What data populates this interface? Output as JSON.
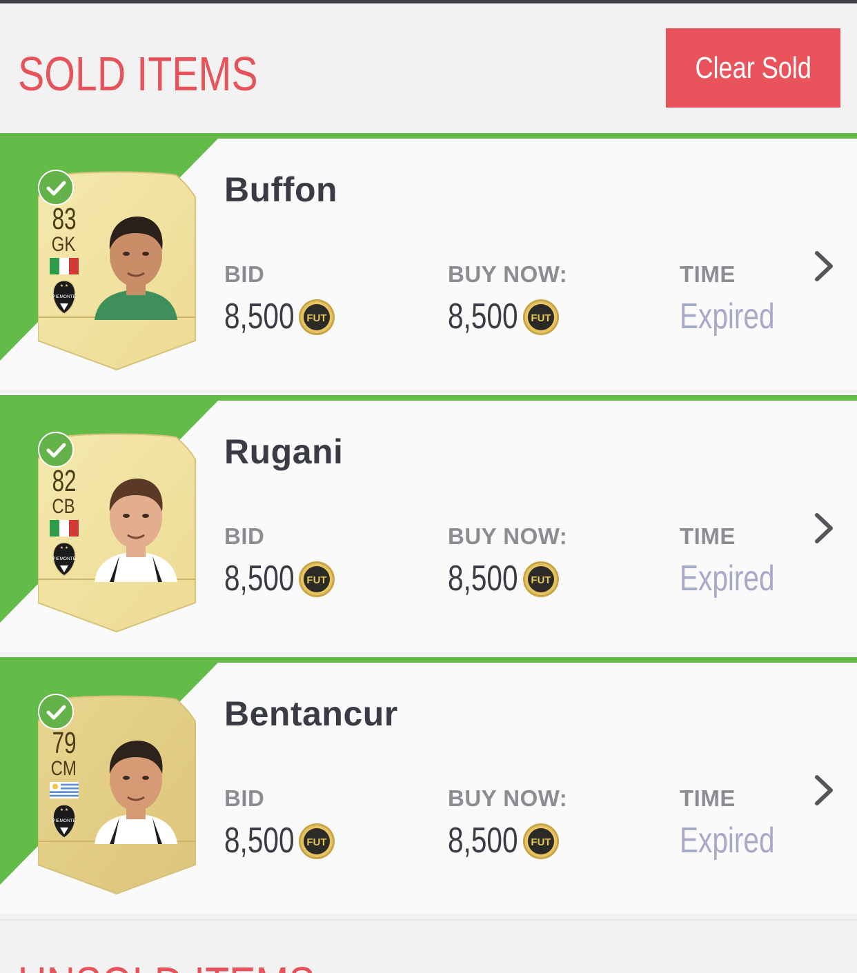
{
  "header": {
    "title": "SOLD ITEMS",
    "clear_button": "Clear Sold"
  },
  "labels": {
    "bid": "BID",
    "buy_now": "BUY NOW:",
    "time": "TIME"
  },
  "items": [
    {
      "name": "Buffon",
      "rating": "83",
      "position": "GK",
      "nation": "italy-flag",
      "club": "PIEMONTE",
      "bid": "8,500",
      "buy_now": "8,500",
      "time": "Expired",
      "status": "sold"
    },
    {
      "name": "Rugani",
      "rating": "82",
      "position": "CB",
      "nation": "italy-flag",
      "club": "PIEMONTE",
      "bid": "8,500",
      "buy_now": "8,500",
      "time": "Expired",
      "status": "sold"
    },
    {
      "name": "Bentancur",
      "rating": "79",
      "position": "CM",
      "nation": "uruguay-flag",
      "club": "PIEMONTE",
      "bid": "8,500",
      "buy_now": "8,500",
      "time": "Expired",
      "status": "sold"
    }
  ],
  "coin_label": "FUT",
  "next_section": {
    "title": "UNSOLD ITEMS"
  },
  "colors": {
    "accent_red": "#e9535c",
    "sold_green": "#62bc47",
    "card_gold": "#e8d48a",
    "expired_text": "#a8a8c8"
  }
}
